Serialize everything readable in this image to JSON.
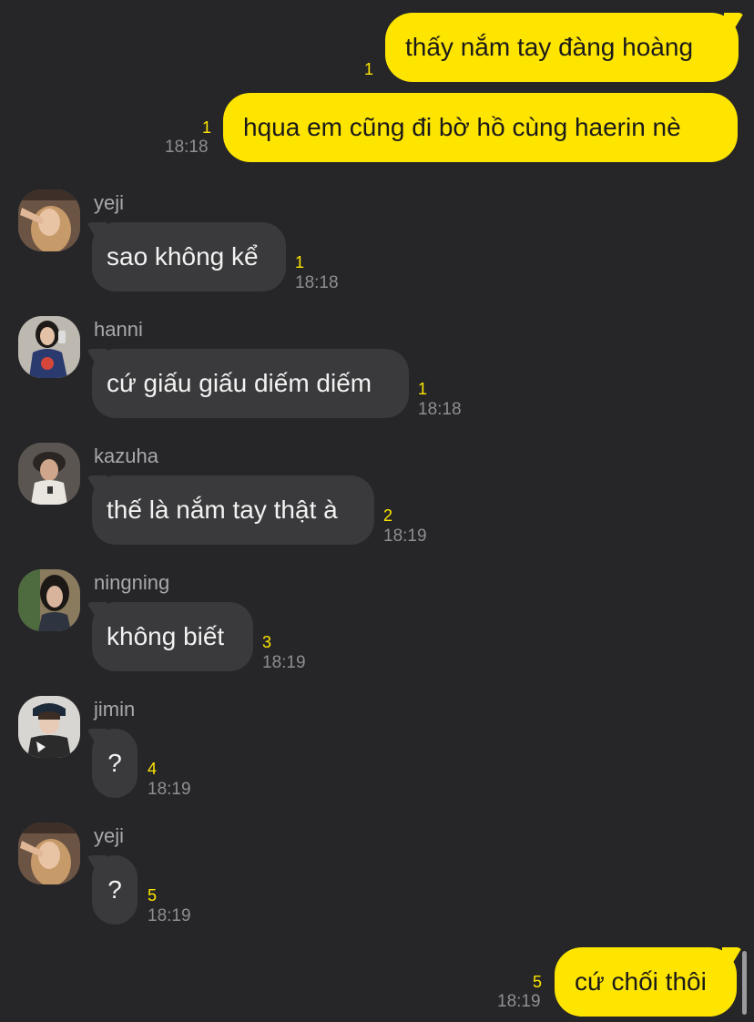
{
  "messages": {
    "m1": {
      "text": "thấy nắm tay đàng hoàng",
      "unread": "1"
    },
    "m2": {
      "text": "hqua em cũng đi bờ hồ cùng haerin nè",
      "unread": "1",
      "time": "18:18"
    },
    "m3": {
      "sender": "yeji",
      "text": "sao không kể",
      "unread": "1",
      "time": "18:18"
    },
    "m4": {
      "sender": "hanni",
      "text": "cứ giấu giấu diếm diếm",
      "unread": "1",
      "time": "18:18"
    },
    "m5": {
      "sender": "kazuha",
      "text": "thế là nắm tay thật à",
      "unread": "2",
      "time": "18:19"
    },
    "m6": {
      "sender": "ningning",
      "text": "không biết",
      "unread": "3",
      "time": "18:19"
    },
    "m7": {
      "sender": "jimin",
      "text": "?",
      "unread": "4",
      "time": "18:19"
    },
    "m8": {
      "sender": "yeji",
      "text": "?",
      "unread": "5",
      "time": "18:19"
    },
    "m9": {
      "text": "cứ chối thôi",
      "unread": "5",
      "time": "18:19"
    }
  },
  "colors": {
    "background": "#262628",
    "outgoing_bubble": "#fee500",
    "incoming_bubble": "#3a3a3c",
    "unread_count": "#fee500",
    "timestamp": "#8e8e93"
  }
}
